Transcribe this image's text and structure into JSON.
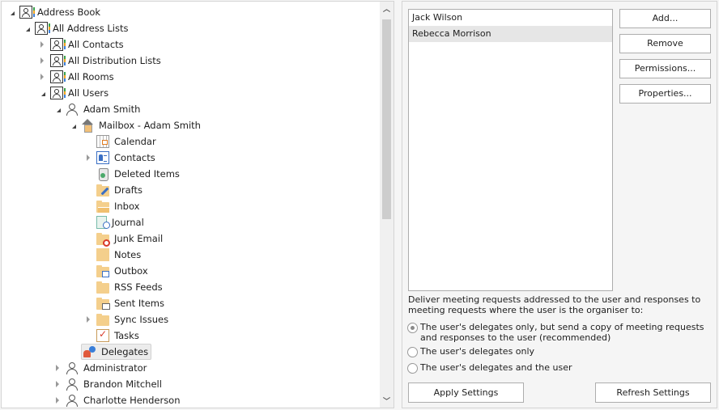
{
  "tree": {
    "items": [
      {
        "label": "Address Book",
        "icon": "address-book-icon",
        "expander": "open"
      },
      {
        "label": "All Address Lists",
        "icon": "address-book-icon",
        "expander": "open"
      },
      {
        "label": "All Contacts",
        "icon": "address-book-icon",
        "expander": "closed"
      },
      {
        "label": "All Distribution Lists",
        "icon": "address-book-icon",
        "expander": "closed"
      },
      {
        "label": "All Rooms",
        "icon": "address-book-icon",
        "expander": "closed"
      },
      {
        "label": "All Users",
        "icon": "address-book-icon",
        "expander": "open"
      },
      {
        "label": "Adam Smith",
        "icon": "user-icon",
        "expander": "open"
      },
      {
        "label": "Mailbox - Adam Smith",
        "icon": "mailbox-home-icon",
        "expander": "open"
      },
      {
        "label": "Calendar",
        "icon": "calendar-icon",
        "expander": "none"
      },
      {
        "label": "Contacts",
        "icon": "contacts-icon",
        "expander": "closed"
      },
      {
        "label": "Deleted Items",
        "icon": "deleted-items-icon",
        "expander": "none"
      },
      {
        "label": "Drafts",
        "icon": "drafts-folder-icon",
        "expander": "none"
      },
      {
        "label": "Inbox",
        "icon": "inbox-folder-icon",
        "expander": "none"
      },
      {
        "label": "Journal",
        "icon": "journal-icon",
        "expander": "none"
      },
      {
        "label": "Junk Email",
        "icon": "junk-email-folder-icon",
        "expander": "none"
      },
      {
        "label": "Notes",
        "icon": "notes-icon",
        "expander": "none"
      },
      {
        "label": "Outbox",
        "icon": "outbox-folder-icon",
        "expander": "none"
      },
      {
        "label": "RSS Feeds",
        "icon": "folder-icon",
        "expander": "none"
      },
      {
        "label": "Sent Items",
        "icon": "sent-items-folder-icon",
        "expander": "none"
      },
      {
        "label": "Sync Issues",
        "icon": "folder-icon",
        "expander": "closed"
      },
      {
        "label": "Tasks",
        "icon": "tasks-icon",
        "expander": "none"
      },
      {
        "label": "Delegates",
        "icon": "delegates-icon",
        "expander": "none",
        "selected": true
      },
      {
        "label": "Administrator",
        "icon": "user-icon",
        "expander": "closed"
      },
      {
        "label": "Brandon Mitchell",
        "icon": "user-icon",
        "expander": "closed"
      },
      {
        "label": "Charlotte Henderson",
        "icon": "user-icon",
        "expander": "closed"
      }
    ]
  },
  "delegates": {
    "list": [
      {
        "name": "Jack Wilson",
        "selected": false
      },
      {
        "name": "Rebecca Morrison",
        "selected": true
      }
    ],
    "buttons": {
      "add": "Add...",
      "remove": "Remove",
      "permissions": "Permissions...",
      "properties": "Properties..."
    },
    "description": "Deliver meeting requests addressed to the user and responses to meeting requests where the user is the organiser to:",
    "options": [
      {
        "label": "The user's delegates only, but send a copy of meeting requests and responses to the user (recommended)",
        "checked": true
      },
      {
        "label": "The user's delegates only",
        "checked": false
      },
      {
        "label": "The user's delegates and the user",
        "checked": false
      }
    ],
    "apply_label": "Apply Settings",
    "refresh_label": "Refresh Settings"
  },
  "colors": {
    "selection_bg": "#ececec",
    "list_selection_bg": "#e6e6e6",
    "folder": "#f4cf8c"
  }
}
